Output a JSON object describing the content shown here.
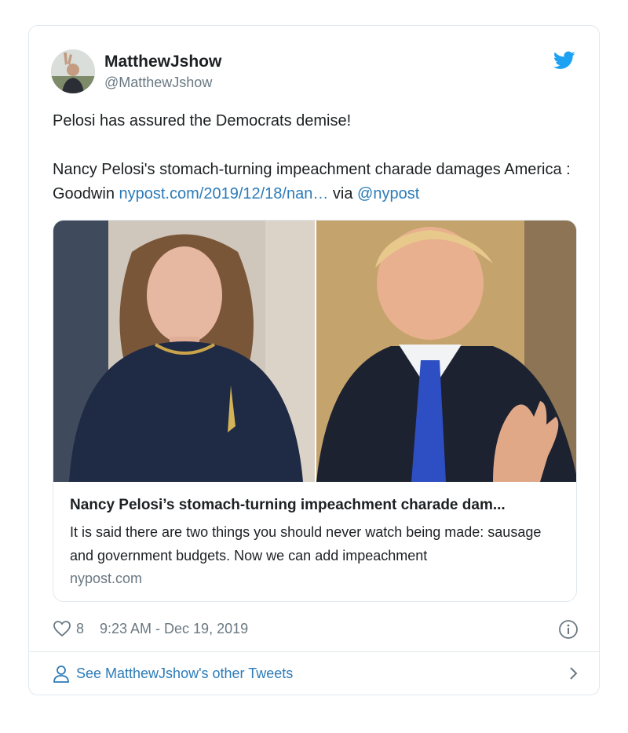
{
  "user": {
    "display_name": "MatthewJshow",
    "handle": "@MatthewJshow"
  },
  "tweet": {
    "line1": "Pelosi has assured the Democrats demise!",
    "line2_text": "Nancy Pelosi's stomach-turning impeachment charade damages America : Goodwin ",
    "line2_link": "nypost.com/2019/12/18/nan…",
    "via": " via ",
    "mention": "@nypost"
  },
  "card": {
    "title": "Nancy Pelosi’s stomach-turning impeachment charade dam...",
    "description": "It is said there are two things you should never watch being made: sausage and government budgets. Now we can add impeachment",
    "domain": "nypost.com"
  },
  "meta": {
    "likes": "8",
    "timestamp": "9:23 AM - Dec 19, 2019"
  },
  "footer": {
    "other_tweets": "See MatthewJshow's other Tweets"
  },
  "colors": {
    "link": "#2b7bb9",
    "twitter_blue": "#1da1f2",
    "muted": "#697882",
    "border": "#e1e8ed"
  },
  "icons": {
    "brand": "twitter-bird-icon",
    "like": "heart-icon",
    "info": "info-icon",
    "profile": "person-icon",
    "chevron": "chevron-right-icon"
  }
}
